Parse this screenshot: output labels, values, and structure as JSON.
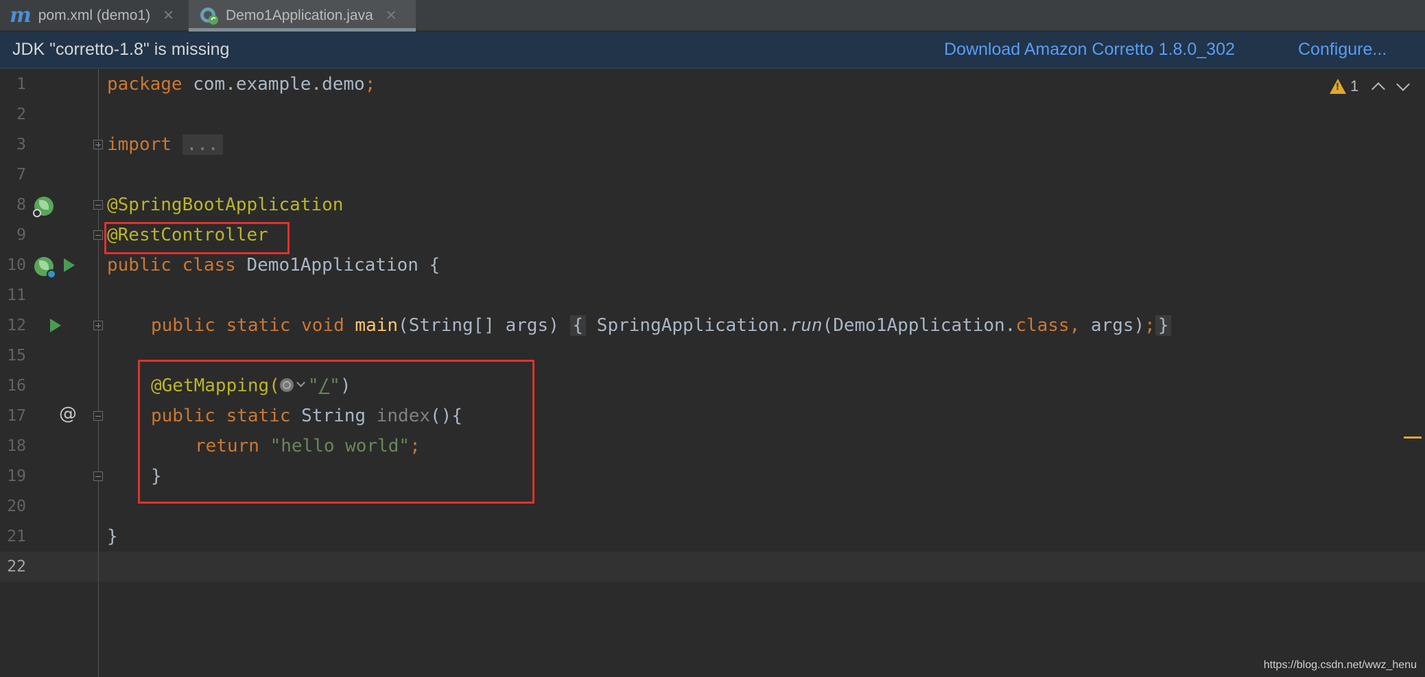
{
  "tabs": [
    {
      "label": "pom.xml (demo1)",
      "icon": "maven-icon",
      "active": false
    },
    {
      "label": "Demo1Application.java",
      "icon": "spring-class-icon",
      "active": true
    }
  ],
  "banner": {
    "message": "JDK \"corretto-1.8\" is missing",
    "download_link": "Download Amazon Corretto 1.8.0_302",
    "configure_link": "Configure..."
  },
  "inspection": {
    "warning_count": "1"
  },
  "line_numbers": [
    "1",
    "2",
    "3",
    "7",
    "8",
    "9",
    "10",
    "11",
    "12",
    "15",
    "16",
    "17",
    "18",
    "19",
    "20",
    "21",
    "22"
  ],
  "code": {
    "l1_kw": "package",
    "l1_rest": " com.example.demo",
    "l1_semi": ";",
    "l3_kw": "import",
    "l3_fold": "...",
    "l8_ann": "@SpringBootApplication",
    "l9_ann": "@RestController",
    "l10_kw": "public class",
    "l10_rest": " Demo1Application {",
    "l12_kw": "public static void",
    "l12_fn": "main",
    "l12_params": "(String[] args) ",
    "l12_brace_open": "{",
    "l12_call": " SpringApplication.",
    "l12_run": "run",
    "l12_args_start": "(Demo1Application.",
    "l12_class": "class,",
    "l12_args_end": " args)",
    "l12_semi": ";",
    "l12_brace_close": "}",
    "l16_ann": "@GetMapping(",
    "l16_quote1": "\"",
    "l16_path": "/",
    "l16_quote2": "\"",
    "l16_close": ")",
    "l17_kw": "public static",
    "l17_type": " String ",
    "l17_fn": "index",
    "l17_rest": "(){",
    "l18_kw": "return",
    "l18_str": " \"hello world\"",
    "l18_semi": ";",
    "l19": "}",
    "l21": "}"
  },
  "watermark": "https://blog.csdn.net/wwz_henu"
}
